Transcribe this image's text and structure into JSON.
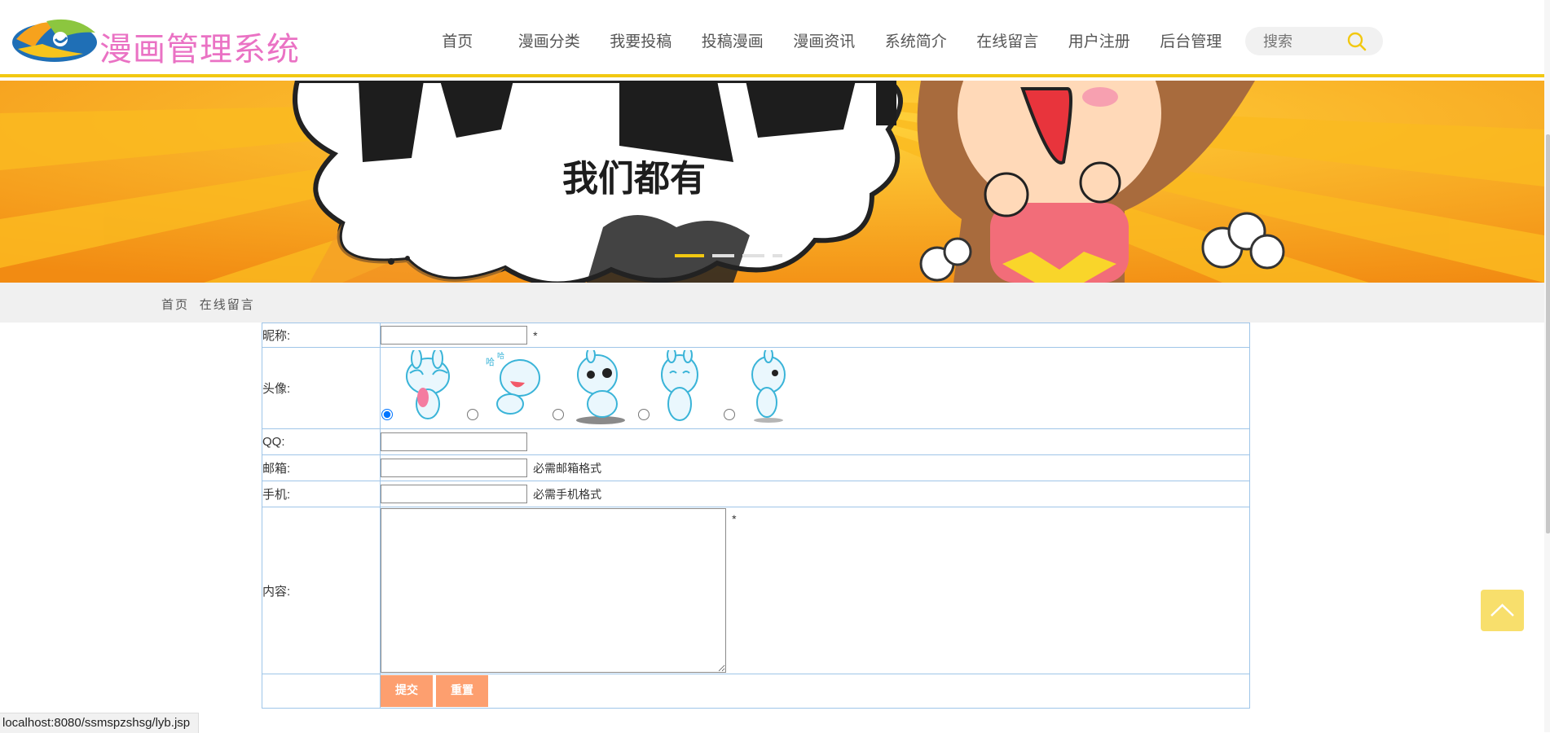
{
  "header": {
    "site_title": "漫画管理系统",
    "nav": [
      "首页",
      "漫画分类",
      "我要投稿",
      "投稿漫画",
      "漫画资讯",
      "系统简介",
      "在线留言",
      "用户注册",
      "后台管理"
    ],
    "search_placeholder": "搜索",
    "accent_color": "#f2c811"
  },
  "banner": {
    "text": "我们都有",
    "slides_count": 4,
    "active_slide": 1
  },
  "breadcrumb": [
    "首页",
    "在线留言"
  ],
  "form": {
    "nickname_label": "昵称:",
    "nickname_required": "*",
    "avatar_label": "头像:",
    "avatar_count": 5,
    "avatar_selected": 1,
    "qq_label": "QQ:",
    "email_label": "邮箱:",
    "email_hint": "必需邮箱格式",
    "phone_label": "手机:",
    "phone_hint": "必需手机格式",
    "content_label": "内容:",
    "content_required": "*",
    "submit_label": "提交",
    "reset_label": "重置"
  },
  "status_bar": {
    "url": "localhost:8080/ssmspzshsg/lyb.jsp"
  }
}
